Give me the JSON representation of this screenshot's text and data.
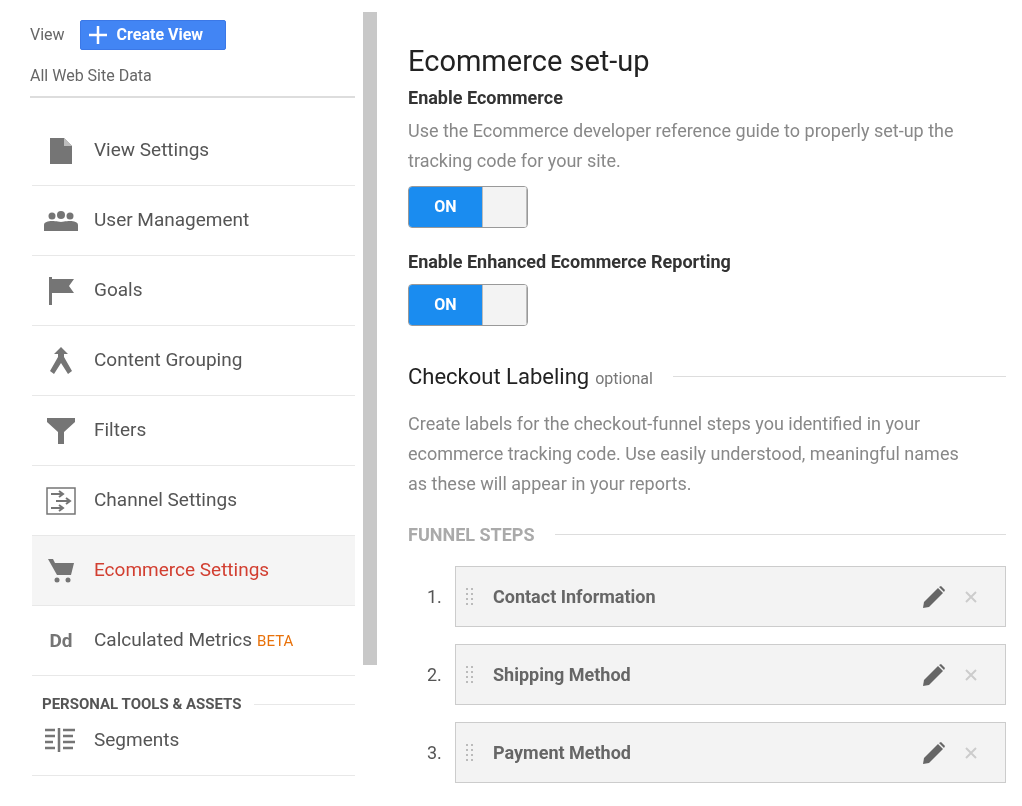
{
  "sidebar": {
    "view_label": "View",
    "create_button": "Create View",
    "view_name": "All Web Site Data",
    "items": [
      {
        "label": "View Settings",
        "kind": "document",
        "selected": false
      },
      {
        "label": "User Management",
        "kind": "people",
        "selected": false
      },
      {
        "label": "Goals",
        "kind": "flag",
        "selected": false
      },
      {
        "label": "Content Grouping",
        "kind": "merge",
        "selected": false
      },
      {
        "label": "Filters",
        "kind": "filter",
        "selected": false
      },
      {
        "label": "Channel Settings",
        "kind": "channel",
        "selected": false
      },
      {
        "label": "Ecommerce Settings",
        "kind": "cart",
        "selected": true
      },
      {
        "label": "Calculated Metrics",
        "kind": "text",
        "icon_text": "Dd",
        "badge": "BETA",
        "selected": false
      }
    ],
    "section": "PERSONAL TOOLS & ASSETS",
    "section_items": [
      {
        "label": "Segments",
        "kind": "segments",
        "selected": false
      }
    ]
  },
  "main": {
    "title": "Ecommerce set-up",
    "settings": [
      {
        "heading": "Enable Ecommerce",
        "description": "Use the Ecommerce developer reference guide to properly set-up the tracking code for your site.",
        "toggle": {
          "on": true,
          "label": "ON"
        }
      },
      {
        "heading": "Enable Enhanced Ecommerce Reporting",
        "toggle": {
          "on": true,
          "label": "ON"
        }
      }
    ],
    "checkout": {
      "title": "Checkout Labeling",
      "note": "optional",
      "description": "Create labels for the checkout-funnel steps you identified in your ecommerce tracking code. Use easily understood, meaningful names as these will appear in your reports.",
      "funnel_heading": "FUNNEL STEPS",
      "steps": [
        {
          "number": "1.",
          "label": "Contact Information"
        },
        {
          "number": "2.",
          "label": "Shipping Method"
        },
        {
          "number": "3.",
          "label": "Payment Method"
        }
      ]
    }
  }
}
